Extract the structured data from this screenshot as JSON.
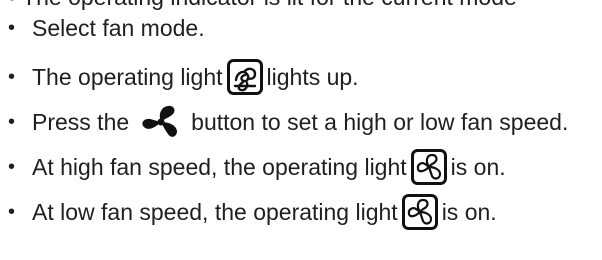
{
  "partial_top_line": "The operating indicator is lit for the current mode",
  "items": [
    {
      "before": "Select fan mode.",
      "icon": "",
      "after": ""
    },
    {
      "before": "The operating light",
      "icon": "fan-mode-light-icon",
      "after": "lights up."
    },
    {
      "before": "Press the",
      "icon": "fan-speed-button-icon",
      "after": "button to set a high or low fan speed."
    },
    {
      "before": "At high fan speed, the operating light",
      "icon": "high-fan-speed-light-icon",
      "after": "is on."
    },
    {
      "before": "At low fan speed, the operating light",
      "icon": "low-fan-speed-light-icon",
      "after": "is on."
    }
  ],
  "bullet": "•"
}
